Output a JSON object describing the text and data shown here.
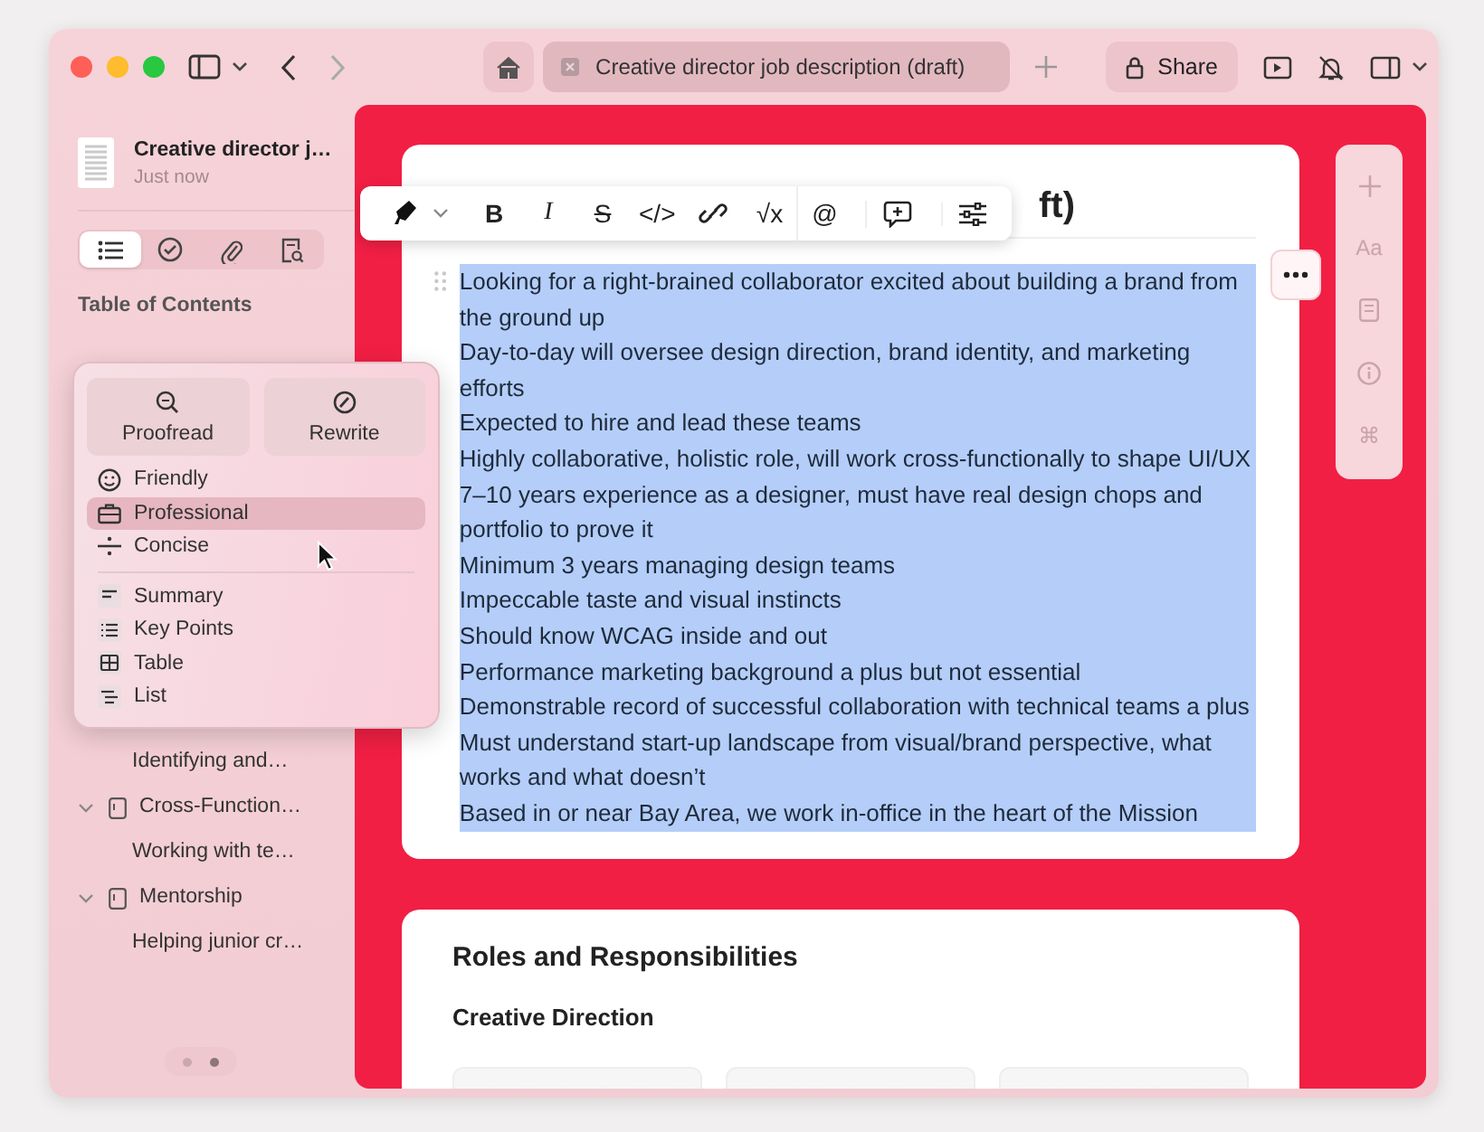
{
  "window": {
    "tab_title": "Creative director job description (draft)",
    "share_label": "Share"
  },
  "sidebar": {
    "doc_title": "Creative director j…",
    "doc_time": "Just now",
    "segments": [
      {
        "selected": true
      },
      {
        "selected": false
      },
      {
        "selected": false
      },
      {
        "selected": false
      }
    ],
    "toc_heading": "Table of Contents",
    "toc": [
      {
        "kind": "entry",
        "label": "Identifying and…"
      },
      {
        "kind": "section",
        "label": "Cross-Function…",
        "expanded": true,
        "children": [
          {
            "label": "Working with te…"
          }
        ]
      },
      {
        "kind": "section",
        "label": "Mentorship",
        "expanded": true,
        "children": [
          {
            "label": "Helping junior cr…"
          }
        ]
      }
    ],
    "pages": [
      {
        "selected": false
      },
      {
        "selected": true
      }
    ]
  },
  "toolbar": [
    {
      "kind": "highlighter"
    },
    {
      "kind": "caret"
    },
    {
      "kind": "glyph",
      "label": "B"
    },
    {
      "kind": "glyph",
      "label": "I"
    },
    {
      "kind": "glyph",
      "label": "S"
    },
    {
      "kind": "glyph",
      "label": "</>"
    },
    {
      "kind": "link"
    },
    {
      "kind": "glyph",
      "label": "√x"
    },
    {
      "kind": "glyph",
      "label": "@"
    },
    {
      "kind": "comment"
    },
    {
      "kind": "sliders"
    }
  ],
  "document": {
    "heading_visible": "ft)",
    "selected": true,
    "paragraphs": [
      "Looking for a right-brained collaborator excited about building a brand from the ground up",
      "Day-to-day will oversee design direction, brand identity, and marketing efforts",
      "Expected to hire and lead these teams",
      "Highly collaborative, holistic role, will work cross-functionally to shape UI/UX",
      "7–10 years experience as a designer, must have real design chops and portfolio to prove it",
      "Minimum 3 years managing design teams",
      "Impeccable taste and visual instincts",
      "Should know WCAG inside and out",
      "Performance marketing background a plus but not essential",
      "Demonstrable record of successful collaboration with technical teams a plus",
      "Must understand start-up landscape from visual/brand perspective, what works and what doesn’t",
      "Based in or near Bay Area, we work in-office in the heart of the Mission"
    ]
  },
  "section": {
    "title": "Roles and Responsibilities",
    "subtitle": "Creative Direction"
  },
  "side_panel": [
    {
      "kind": "plus"
    },
    {
      "kind": "text",
      "label": "Aa"
    },
    {
      "kind": "doc"
    },
    {
      "kind": "info"
    },
    {
      "kind": "command",
      "label": "⌘"
    }
  ],
  "writing_tools": {
    "actions": [
      {
        "kind": "proofread",
        "label": "Proofread"
      },
      {
        "kind": "rewrite",
        "label": "Rewrite"
      }
    ],
    "tones": [
      {
        "kind": "smile",
        "label": "Friendly",
        "selected": false
      },
      {
        "kind": "briefcase",
        "label": "Professional",
        "selected": true
      },
      {
        "kind": "divide",
        "label": "Concise",
        "selected": false
      }
    ],
    "formats": [
      {
        "kind": "summary",
        "label": "Summary"
      },
      {
        "kind": "points",
        "label": "Key Points"
      },
      {
        "kind": "table",
        "label": "Table"
      },
      {
        "kind": "list",
        "label": "List"
      }
    ]
  }
}
